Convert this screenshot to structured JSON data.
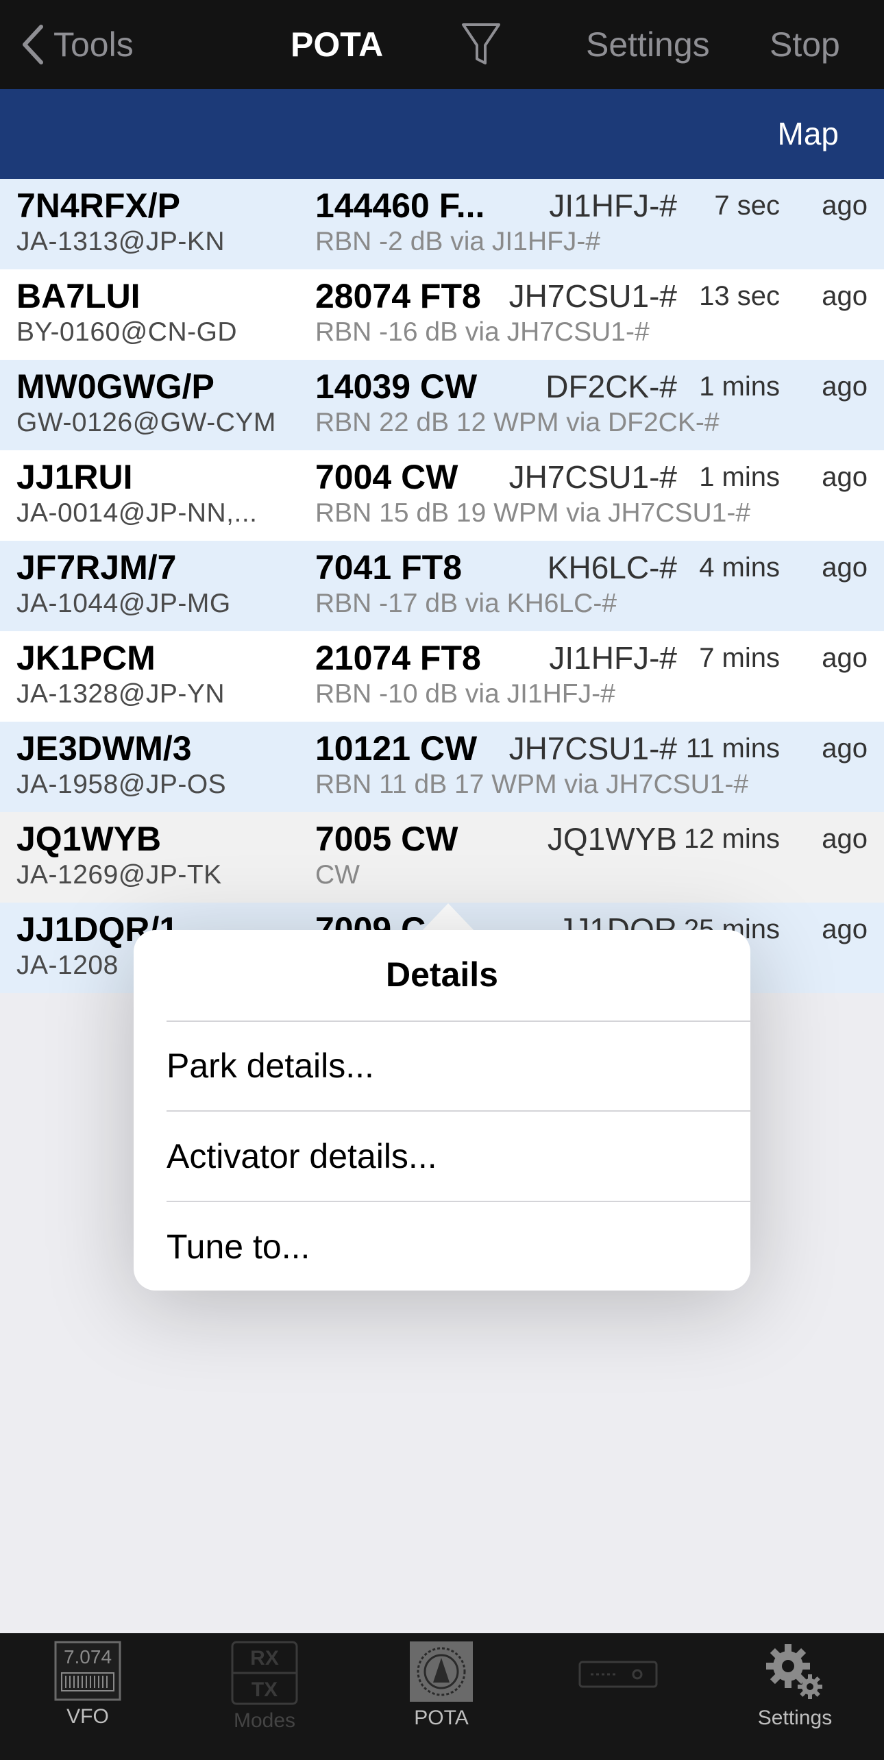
{
  "navbar": {
    "back_label": "Tools",
    "title": "POTA",
    "settings_label": "Settings",
    "stop_label": "Stop"
  },
  "subbar": {
    "map_label": "Map"
  },
  "spots": [
    {
      "call": "7N4RFX/P",
      "park": "JA-1313@JP-KN",
      "freq": "144460 F...",
      "spotter": "JI1HFJ-#",
      "age": "7 sec",
      "ago": "ago",
      "comment": "RBN -2 dB via JI1HFJ-#"
    },
    {
      "call": "BA7LUI",
      "park": "BY-0160@CN-GD",
      "freq": "28074 FT8",
      "spotter": "JH7CSU1-#",
      "age": "13 sec",
      "ago": "ago",
      "comment": "RBN -16 dB via JH7CSU1-#"
    },
    {
      "call": "MW0GWG/P",
      "park": "GW-0126@GW-CYM",
      "freq": "14039 CW",
      "spotter": "DF2CK-#",
      "age": "1 mins",
      "ago": "ago",
      "comment": "RBN 22 dB 12 WPM via DF2CK-#"
    },
    {
      "call": "JJ1RUI",
      "park": "JA-0014@JP-NN,...",
      "freq": "7004 CW",
      "spotter": "JH7CSU1-#",
      "age": "1 mins",
      "ago": "ago",
      "comment": "RBN 15 dB 19 WPM via JH7CSU1-#"
    },
    {
      "call": "JF7RJM/7",
      "park": "JA-1044@JP-MG",
      "freq": "7041 FT8",
      "spotter": "KH6LC-#",
      "age": "4 mins",
      "ago": "ago",
      "comment": "RBN -17 dB via KH6LC-#"
    },
    {
      "call": "JK1PCM",
      "park": "JA-1328@JP-YN",
      "freq": "21074 FT8",
      "spotter": "JI1HFJ-#",
      "age": "7 mins",
      "ago": "ago",
      "comment": "RBN -10 dB via JI1HFJ-#"
    },
    {
      "call": "JE3DWM/3",
      "park": "JA-1958@JP-OS",
      "freq": "10121 CW",
      "spotter": "JH7CSU1-#",
      "age": "11 mins",
      "ago": "ago",
      "comment": "RBN 11 dB 17 WPM via JH7CSU1-#"
    },
    {
      "call": "JQ1WYB",
      "park": "JA-1269@JP-TK",
      "freq": "7005 CW",
      "spotter": "JQ1WYB",
      "age": "12 mins",
      "ago": "ago",
      "comment": "CW"
    },
    {
      "call": "JJ1DQR/1",
      "park": "JA-1208",
      "freq": "7009 C",
      "spotter": "JJ1DQR",
      "age": "25 mins",
      "ago": "ago",
      "comment": ""
    }
  ],
  "popover": {
    "title": "Details",
    "items": [
      "Park details...",
      "Activator details...",
      "Tune to..."
    ]
  },
  "tabbar": {
    "vfo_readout": "7.074",
    "modes_rx": "RX",
    "modes_tx": "TX",
    "tabs": [
      "VFO",
      "Modes",
      "POTA",
      "",
      "Settings"
    ]
  },
  "colors": {
    "navbar_bg": "#131313",
    "subbar_bg": "#1c3a78",
    "row_blue": "#e3eefa",
    "row_white": "#ffffff"
  }
}
